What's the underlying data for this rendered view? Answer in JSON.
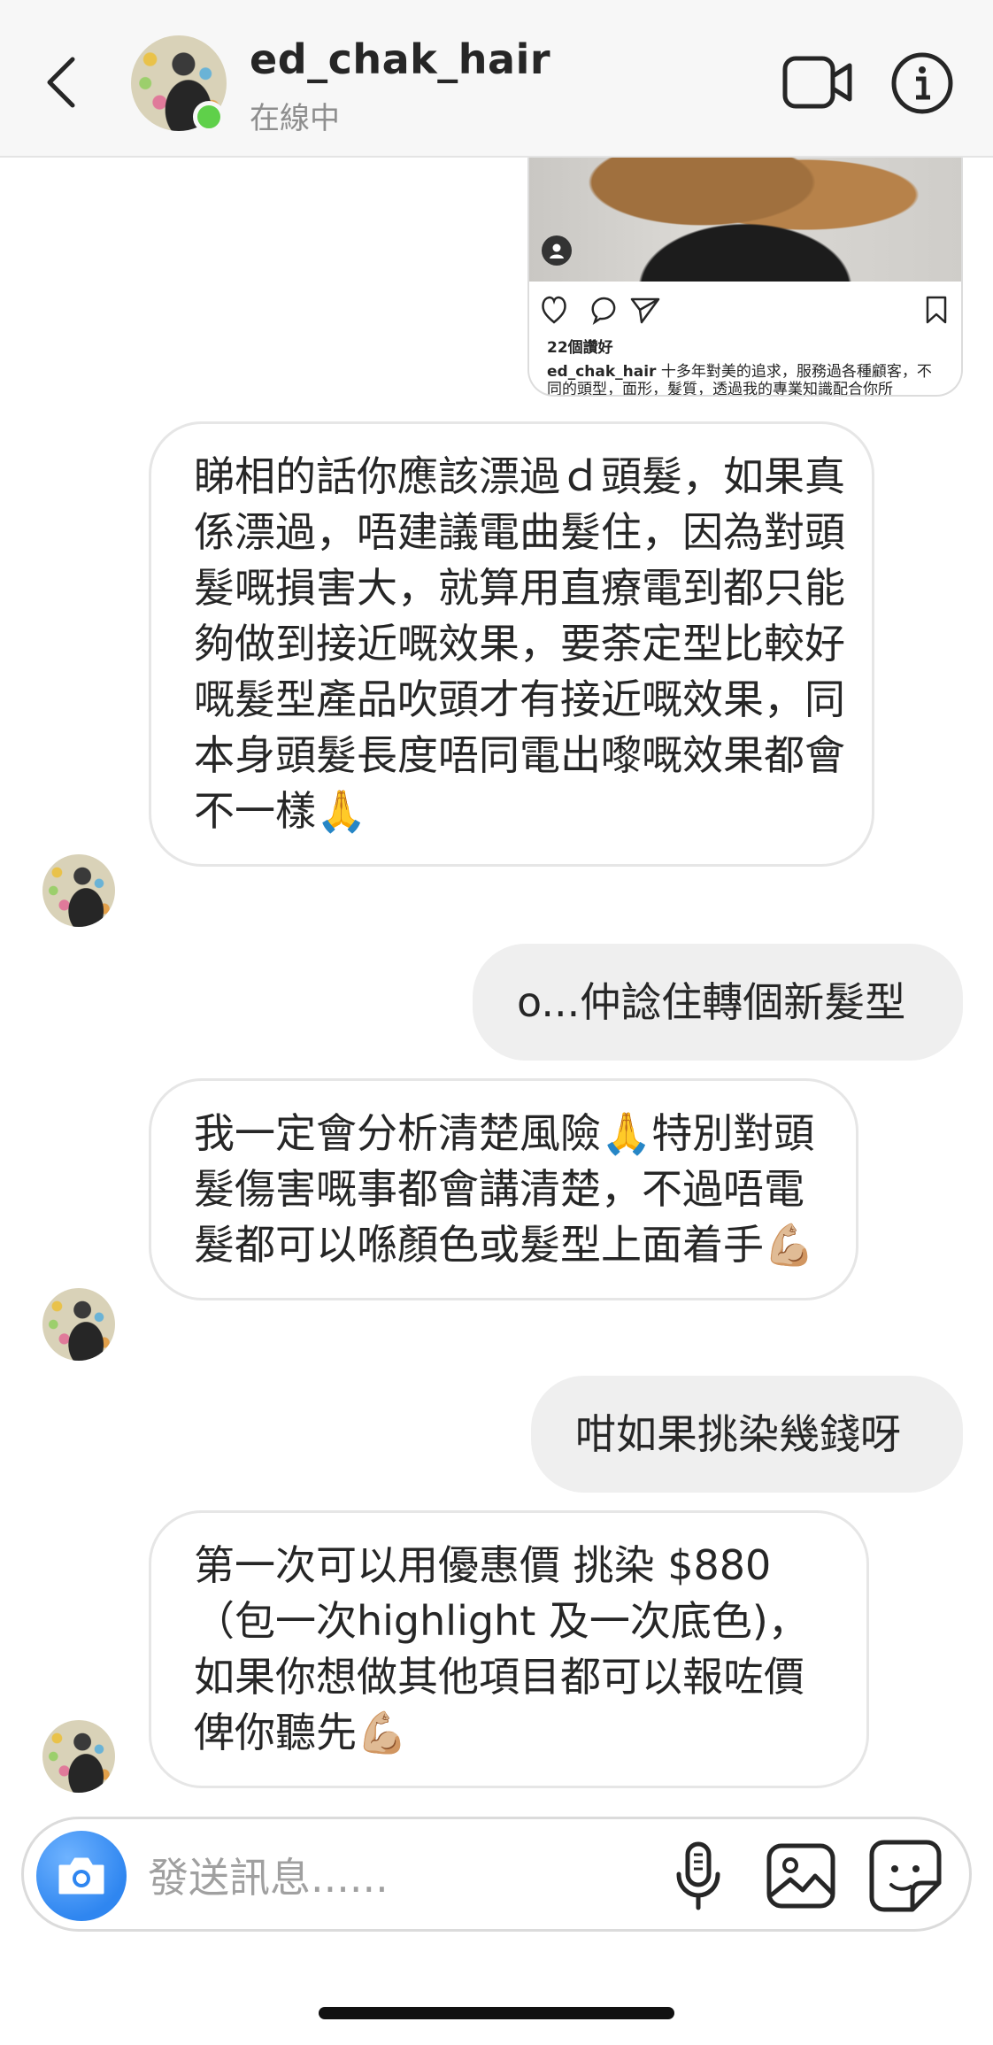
{
  "header": {
    "username": "ed_chak_hair",
    "status": "在線中",
    "icons": {
      "back": "chevron-left-icon",
      "video": "video-camera-icon",
      "info": "info-icon"
    },
    "online_color": "#5fd04a"
  },
  "shared_post": {
    "likes": "22個讚好",
    "caption_user": "ed_chak_hair",
    "caption_text": " 十多年對美的追求，服務過各種顧客，不同的頭型，面形，髮質，透過我的專業知識配合你所"
  },
  "messages": [
    {
      "direction": "received",
      "text": "睇相的話你應該漂過ｄ頭髮，如果真係漂過，唔建議電曲髮住，因為對頭髮嘅損害大，就算用直療電到都只能夠做到接近嘅效果，要荼定型比較好嘅髮型產品吹頭才有接近嘅效果，同本身頭髮長度唔同電出嚟嘅效果都會不一樣🙏"
    },
    {
      "direction": "sent",
      "text": "o...仲諗住轉個新髮型"
    },
    {
      "direction": "received",
      "text": "我一定會分析清楚風險🙏特別對頭髮傷害嘅事都會講清楚，不過唔電髮都可以喺顏色或髮型上面着手💪🏼"
    },
    {
      "direction": "sent",
      "text": "咁如果挑染幾錢呀"
    },
    {
      "direction": "received",
      "text": "第一次可以用優惠價 挑染 $880（包一次highlight 及一次底色)，如果你想做其他項目都可以報咗價俾你聽先💪🏼"
    }
  ],
  "composer": {
    "placeholder": "發送訊息......",
    "accent_color": "#2f86f0",
    "icons": {
      "camera": "camera-icon",
      "mic": "microphone-icon",
      "gallery": "image-icon",
      "sticker": "sticker-icon"
    }
  }
}
